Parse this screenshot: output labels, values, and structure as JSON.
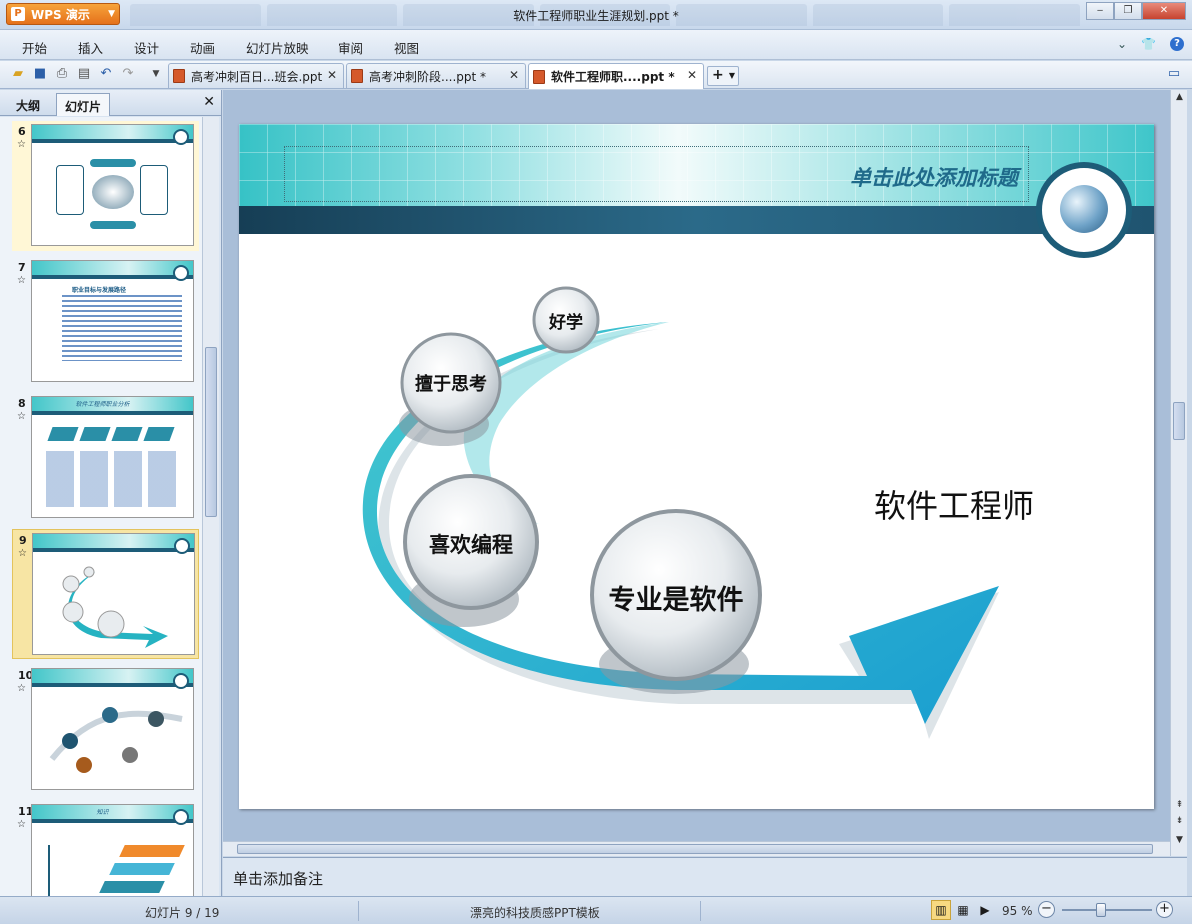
{
  "app": {
    "logo_text": "WPS 演示",
    "window_title": "软件工程师职业生涯规划.ppt *",
    "window_controls": {
      "minimize": "‒",
      "restore": "❐",
      "close": "✕"
    }
  },
  "menu": {
    "items": [
      "开始",
      "插入",
      "设计",
      "动画",
      "幻灯片放映",
      "审阅",
      "视图"
    ]
  },
  "doc_tabs": [
    {
      "label": "高考冲刺百日...班会.ppt",
      "active": false
    },
    {
      "label": "高考冲刺阶段....ppt *",
      "active": false
    },
    {
      "label": "软件工程师职....ppt *",
      "active": true
    }
  ],
  "left_pane": {
    "tabs": [
      "大纲",
      "幻灯片"
    ],
    "active_tab": "幻灯片",
    "thumbnails": [
      {
        "number": "6",
        "state": "highlight",
        "title": ""
      },
      {
        "number": "7",
        "state": "normal",
        "title": "职业目标与发展路径"
      },
      {
        "number": "8",
        "state": "normal",
        "title": "软件工程师职业分析"
      },
      {
        "number": "9",
        "state": "selected",
        "title": ""
      },
      {
        "number": "10",
        "state": "normal",
        "title": ""
      },
      {
        "number": "11",
        "state": "normal",
        "title": "知识"
      }
    ]
  },
  "slide": {
    "title_placeholder": "单击此处添加标题",
    "bubbles": {
      "b1": "好学",
      "b2": "擅于思考",
      "b3": "喜欢编程",
      "b4": "专业是软件"
    },
    "right_label": "软件工程师",
    "colors": {
      "teal": "#2cb7c4",
      "dark_blue": "#1d5c78",
      "arrow": "#27a6cf"
    }
  },
  "notes": {
    "placeholder": "单击添加备注"
  },
  "status": {
    "slide_counter": "幻灯片 9 / 19",
    "template_name": "漂亮的科技质感PPT模板",
    "zoom": "95 %"
  }
}
